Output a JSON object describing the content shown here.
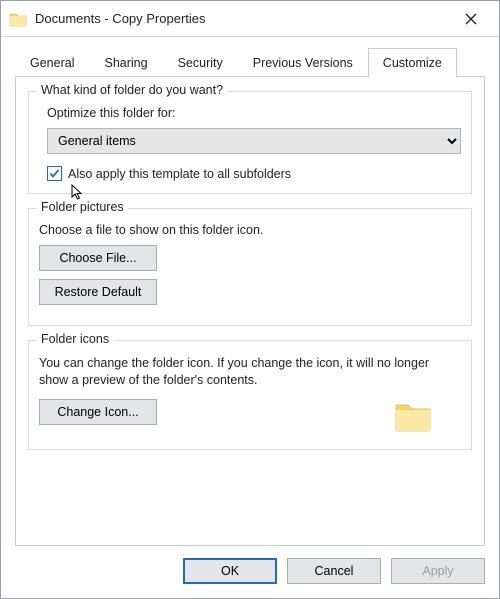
{
  "window": {
    "title": "Documents - Copy Properties"
  },
  "tabs": {
    "items": [
      {
        "label": "General"
      },
      {
        "label": "Sharing"
      },
      {
        "label": "Security"
      },
      {
        "label": "Previous Versions"
      },
      {
        "label": "Customize"
      }
    ],
    "active_index": 4
  },
  "groups": {
    "folder_kind": {
      "legend": "What kind of folder do you want?",
      "optimize_label": "Optimize this folder for:",
      "optimize_value": "General items",
      "subfolders_checkbox_label": "Also apply this template to all subfolders",
      "subfolders_checked": true
    },
    "folder_pictures": {
      "legend": "Folder pictures",
      "desc": "Choose a file to show on this folder icon.",
      "choose_file_btn": "Choose File...",
      "restore_default_btn": "Restore Default"
    },
    "folder_icons": {
      "legend": "Folder icons",
      "desc": "You can change the folder icon. If you change the icon, it will no longer show a preview of the folder's contents.",
      "change_icon_btn": "Change Icon..."
    }
  },
  "footer": {
    "ok": "OK",
    "cancel": "Cancel",
    "apply": "Apply"
  },
  "icons": {
    "title_folder": "folder-icon",
    "close": "close-icon",
    "folder_preview": "folder-icon"
  },
  "colors": {
    "accent": "#1a6fb5",
    "folder_fill": "#f7d56a",
    "folder_fill2": "#fbe9a8"
  }
}
